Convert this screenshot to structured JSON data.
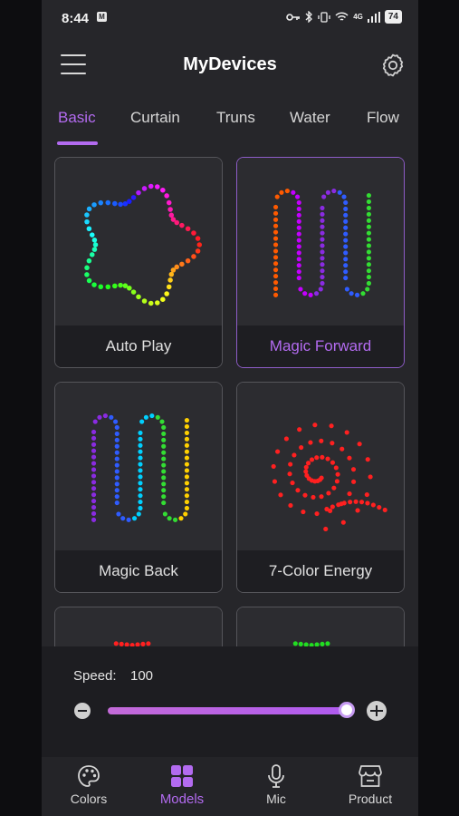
{
  "status": {
    "time": "8:44",
    "battery": "74",
    "network": "4G"
  },
  "header": {
    "title": "MyDevices"
  },
  "tabs": [
    {
      "label": "Basic",
      "active": true
    },
    {
      "label": "Curtain",
      "active": false
    },
    {
      "label": "Truns",
      "active": false
    },
    {
      "label": "Water",
      "active": false
    },
    {
      "label": "Flow",
      "active": false
    }
  ],
  "cards": [
    {
      "label": "Auto Play",
      "selected": false
    },
    {
      "label": "Magic Forward",
      "selected": true
    },
    {
      "label": "Magic Back",
      "selected": false
    },
    {
      "label": "7-Color Energy",
      "selected": false
    }
  ],
  "speed": {
    "label": "Speed:",
    "value": "100",
    "level_percent": 100
  },
  "nav": [
    {
      "label": "Colors",
      "icon": "palette-icon",
      "active": false
    },
    {
      "label": "Models",
      "icon": "grid-icon",
      "active": true
    },
    {
      "label": "Mic",
      "icon": "microphone-icon",
      "active": false
    },
    {
      "label": "Product",
      "icon": "store-icon",
      "active": false
    }
  ],
  "colors": {
    "accent": "#b36bf0",
    "background": "#26262a"
  }
}
